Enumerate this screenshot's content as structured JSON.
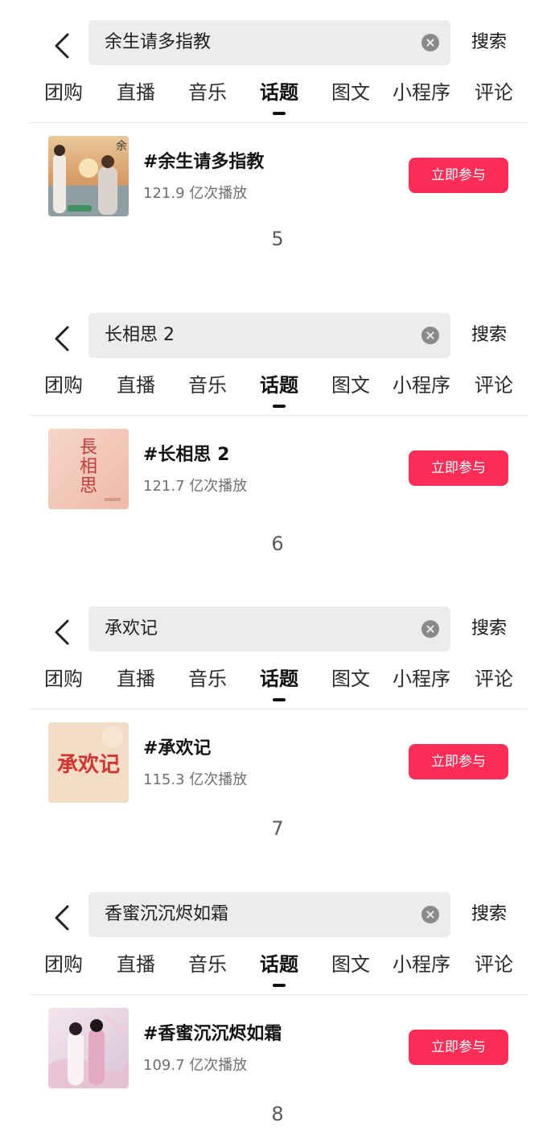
{
  "tabs": [
    "团购",
    "直播",
    "音乐",
    "话题",
    "图文",
    "小程序",
    "评论"
  ],
  "search_button_label": "搜索",
  "join_button_label": "立即参与",
  "panels": [
    {
      "query": "余生请多指教",
      "topic": "#余生请多指教",
      "plays": "121.9 亿次播放",
      "rank": "5",
      "thumb_art_text": "余"
    },
    {
      "query": "长相思 2",
      "topic": "#长相思 2",
      "plays": "121.7 亿次播放",
      "rank": "6",
      "thumb_art_text": "長相思"
    },
    {
      "query": "承欢记",
      "topic": "#承欢记",
      "plays": "115.3 亿次播放",
      "rank": "7",
      "thumb_art_text": "承欢记"
    },
    {
      "query": "香蜜沉沉烬如霜",
      "topic": "#香蜜沉沉烬如霜",
      "plays": "109.7 亿次播放",
      "rank": "8",
      "thumb_art_text": ""
    }
  ],
  "colors": {
    "accent": "#fb2c55",
    "search_bg": "#ececec"
  }
}
